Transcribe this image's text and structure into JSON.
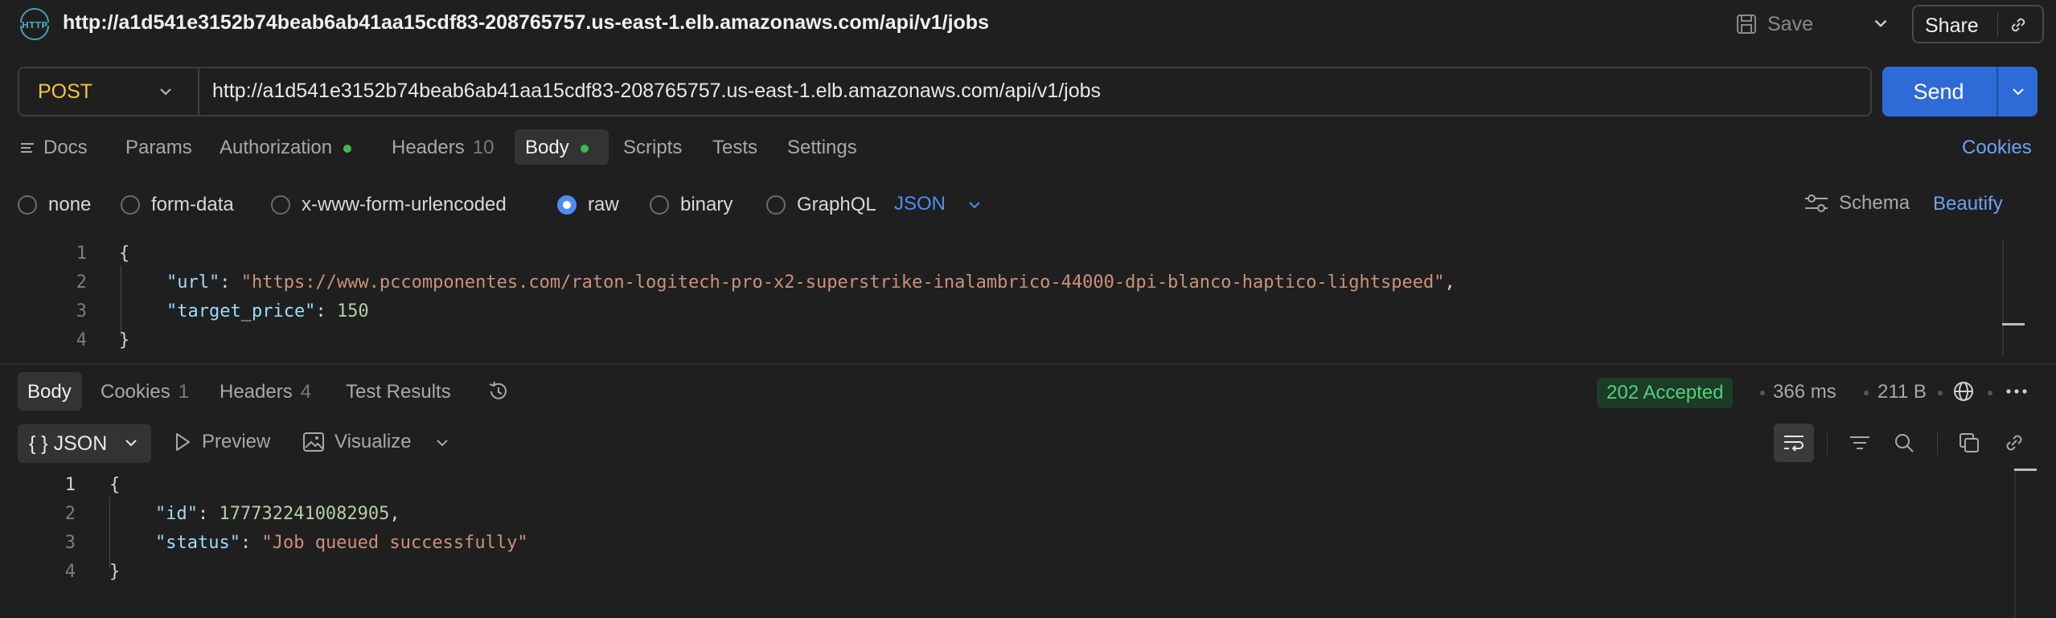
{
  "request": {
    "title": "http://a1d541e3152b74beab6ab41aa15cdf83-208765757.us-east-1.elb.amazonaws.com/api/v1/jobs",
    "save_label": "Save",
    "share_label": "Share",
    "method": "POST",
    "url": "http://a1d541e3152b74beab6ab41aa15cdf83-208765757.us-east-1.elb.amazonaws.com/api/v1/jobs",
    "send_label": "Send"
  },
  "tabs": {
    "docs": "Docs",
    "params": "Params",
    "authorization": "Authorization",
    "headers": "Headers",
    "headers_count": "10",
    "body": "Body",
    "scripts": "Scripts",
    "tests": "Tests",
    "settings": "Settings",
    "cookies": "Cookies"
  },
  "body_types": {
    "none": "none",
    "form_data": "form-data",
    "urlencoded": "x-www-form-urlencoded",
    "raw": "raw",
    "binary": "binary",
    "graphql": "GraphQL",
    "selected": "raw",
    "json_type": "JSON",
    "schema": "Schema",
    "beautify": "Beautify"
  },
  "request_body": {
    "line_numbers": [
      "1",
      "2",
      "3",
      "4"
    ],
    "open_brace": "{",
    "url_key": "\"url\"",
    "url_value": "\"https://www.pccomponentes.com/raton-logitech-pro-x2-superstrike-inalambrico-44000-dpi-blanco-haptico-lightspeed\"",
    "price_key": "\"target_price\"",
    "price_value": "150",
    "close_brace": "}"
  },
  "response": {
    "tabs": {
      "body": "Body",
      "cookies": "Cookies",
      "cookies_count": "1",
      "headers": "Headers",
      "headers_count": "4",
      "test_results": "Test Results"
    },
    "status": "202 Accepted",
    "time": "366 ms",
    "size": "211 B",
    "format": "JSON",
    "format_braces": "{ }",
    "preview": "Preview",
    "visualize": "Visualize",
    "body": {
      "line_numbers": [
        "1",
        "2",
        "3",
        "4"
      ],
      "open_brace": "{",
      "id_key": "\"id\"",
      "id_value": "1777322410082905",
      "status_key": "\"status\"",
      "status_value": "\"Job queued successfully\"",
      "close_brace": "}"
    }
  },
  "colors": {
    "accent": "#2f6bd6",
    "method": "#f5c542",
    "success": "#4fd27a",
    "link": "#6ea0f3"
  }
}
